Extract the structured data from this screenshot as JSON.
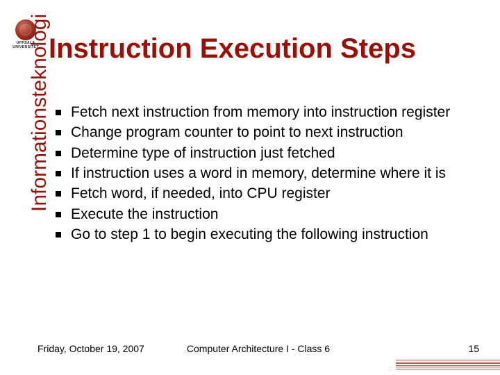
{
  "logo": {
    "line1": "UPPSALA",
    "line2": "UNIVERSITET"
  },
  "title": "Instruction Execution Steps",
  "sidebar": "Informationsteknologi",
  "bullets": [
    "Fetch next instruction from memory into instruction register",
    "Change program counter to point to next instruction",
    "Determine type of instruction just fetched",
    "If instruction uses a word in memory, determine where it is",
    "Fetch word, if needed, into CPU register",
    "Execute the instruction",
    "Go to step 1 to begin executing the following instruction"
  ],
  "footer": {
    "date": "Friday, October 19, 2007",
    "course": "Computer Architecture I - Class 6",
    "page": "15"
  }
}
